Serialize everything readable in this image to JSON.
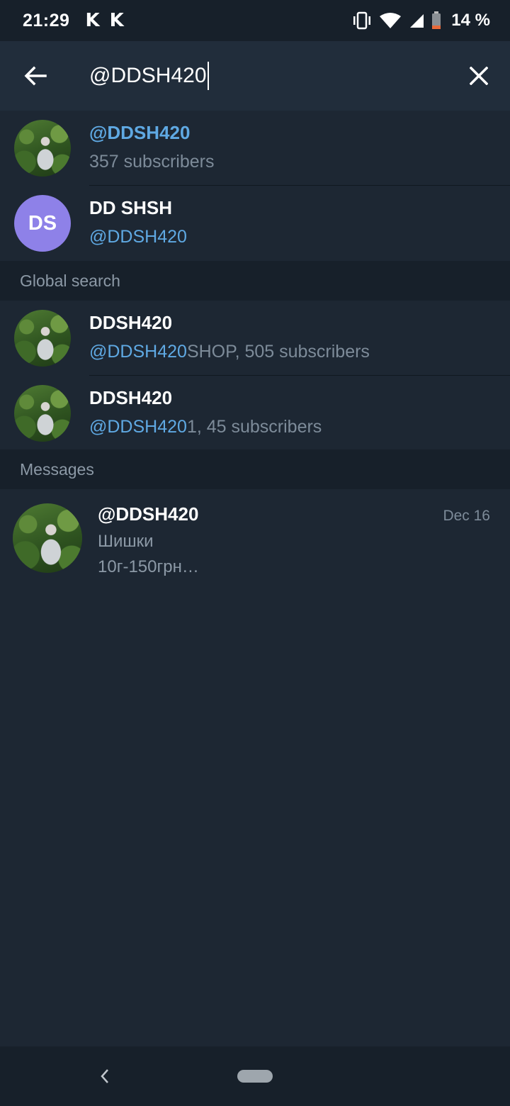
{
  "status_bar": {
    "time": "21:29",
    "app_icons": [
      "K",
      "K"
    ],
    "battery": "14 %"
  },
  "search": {
    "query": "@DDSH420",
    "placeholder": "Search"
  },
  "results": [
    {
      "title": "@DDSH420",
      "subtitle": "357 subscribers",
      "avatar": "photo",
      "title_color": "#5fa9e3"
    },
    {
      "title": "DD SHSH",
      "subtitle_highlight": "@DDSH420",
      "avatar": "initials",
      "initials": "DS",
      "avatar_color": "#8e81e8"
    }
  ],
  "global_search": {
    "header": "Global search",
    "items": [
      {
        "title": "DDSH420",
        "subtitle_highlight": "@DDSH420",
        "subtitle_rest": "SHOP, 505 subscribers"
      },
      {
        "title": "DDSH420",
        "subtitle_highlight": "@DDSH420",
        "subtitle_rest": "1, 45 subscribers"
      }
    ]
  },
  "messages": {
    "header": "Messages",
    "items": [
      {
        "title": "@DDSH420",
        "date": "Dec 16",
        "line1": "Шишки",
        "line2": "10г-150грн…"
      }
    ]
  },
  "colors": {
    "background": "#1d2733",
    "header": "#212d3b",
    "section_header": "#17202a",
    "accent": "#5fa9e3"
  }
}
